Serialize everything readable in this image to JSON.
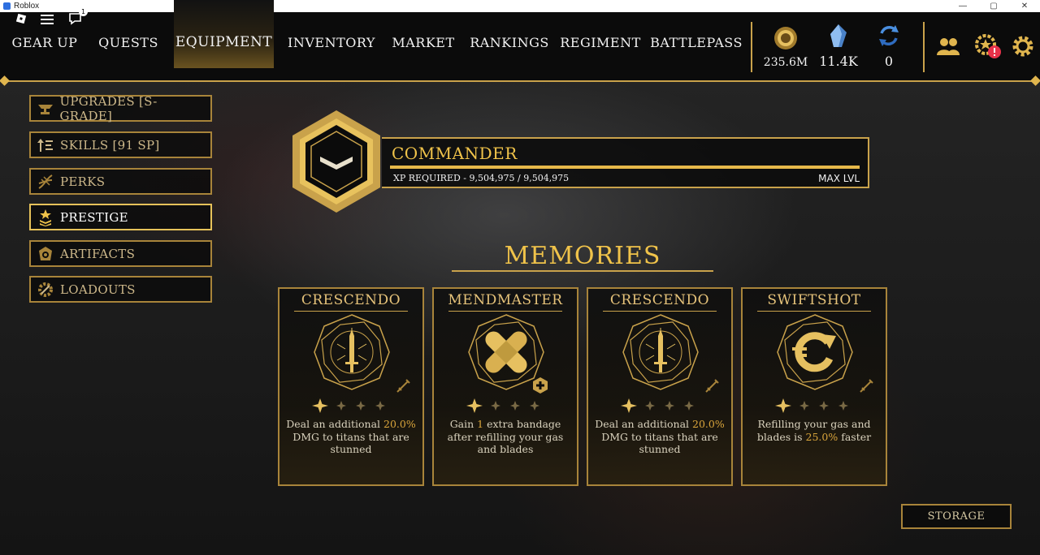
{
  "window": {
    "title": "Roblox",
    "minimize": "—",
    "maximize": "▢",
    "close": "✕"
  },
  "top_icons": {
    "notif_count": "1"
  },
  "nav": {
    "tabs": [
      {
        "label": "GEAR UP"
      },
      {
        "label": "QUESTS"
      },
      {
        "label": "EQUIPMENT"
      },
      {
        "label": "INVENTORY"
      },
      {
        "label": "MARKET"
      },
      {
        "label": "RANKINGS"
      },
      {
        "label": "REGIMENT"
      },
      {
        "label": "BATTLEPASS"
      }
    ],
    "active": "EQUIPMENT"
  },
  "currencies": [
    {
      "icon": "gold-coin-icon",
      "value": "235.6M"
    },
    {
      "icon": "crystal-icon",
      "value": "11.4K"
    },
    {
      "icon": "refresh-token-icon",
      "value": "0"
    }
  ],
  "right_icons": [
    "friends-icon",
    "achievements-icon",
    "settings-icon"
  ],
  "sidebar": {
    "items": [
      {
        "label": "UPGRADES [S- GRADE]",
        "icon": "anvil-icon"
      },
      {
        "label": "SKILLS [91 SP]",
        "icon": "skills-icon"
      },
      {
        "label": "PERKS",
        "icon": "dna-icon"
      },
      {
        "label": "PRESTIGE",
        "icon": "prestige-icon"
      },
      {
        "label": "ARTIFACTS",
        "icon": "artifact-icon"
      },
      {
        "label": "LOADOUTS",
        "icon": "loadout-gear-icon"
      }
    ],
    "active": "PRESTIGE"
  },
  "rank": {
    "name": "COMMANDER",
    "xp_text": "XP REQUIRED - 9,504,975 / 9,504,975",
    "level_text": "MAX LVL",
    "progress": 1.0
  },
  "memories": {
    "title": "MEMORIES",
    "cards": [
      {
        "title": "CRESCENDO",
        "icon": "sword-star-icon",
        "stars": 1,
        "desc_pre": "Deal an additional ",
        "desc_hl": "20.0%",
        "desc_post": " DMG to titans that are stunned"
      },
      {
        "title": "MENDMASTER",
        "icon": "bandage-icon",
        "stars": 1,
        "desc_pre": "Gain ",
        "desc_hl": "1",
        "desc_post": " extra bandage after refilling your gas and blades"
      },
      {
        "title": "CRESCENDO",
        "icon": "sword-star-icon",
        "stars": 1,
        "desc_pre": "Deal an additional ",
        "desc_hl": "20.0%",
        "desc_post": " DMG to titans that are stunned"
      },
      {
        "title": "SWIFTSHOT",
        "icon": "swift-refill-icon",
        "stars": 1,
        "desc_pre": "Refilling your gas and blades is ",
        "desc_hl": "25.0%",
        "desc_post": " faster"
      }
    ]
  },
  "storage": {
    "label": "STORAGE"
  },
  "colors": {
    "gold": "#c9a24b",
    "gold_bright": "#f0c34a",
    "highlight": "#d9a53b",
    "bg": "#0b0b0b"
  }
}
